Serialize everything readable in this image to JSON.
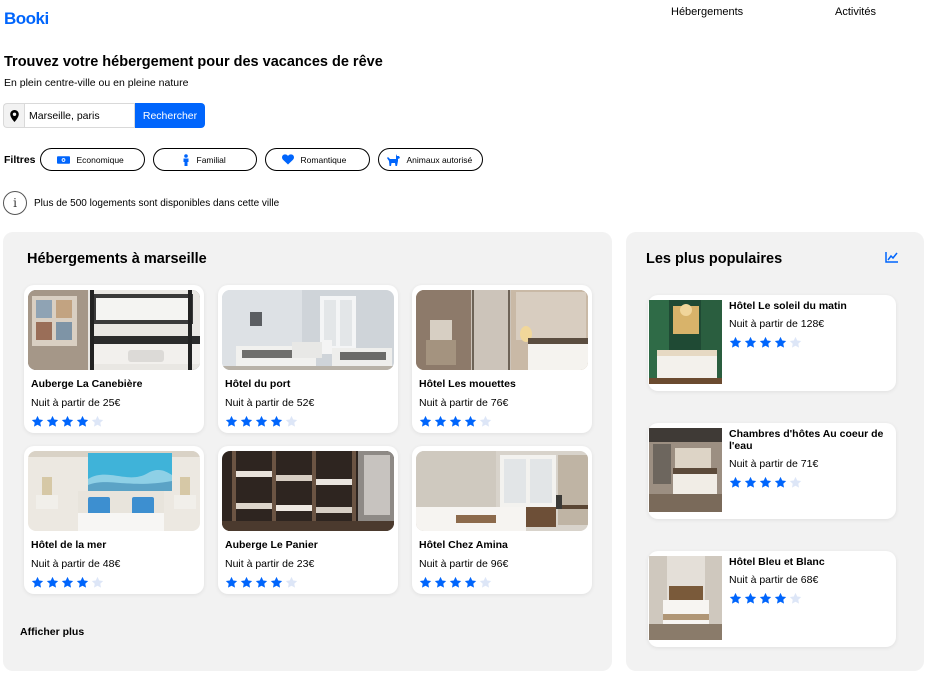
{
  "header": {
    "logo": "Booki",
    "nav": [
      "Hébergements",
      "Activités"
    ]
  },
  "hero": {
    "title": "Trouvez votre hébergement pour des vacances de rêve",
    "subtitle": "En plein centre-ville ou en pleine nature"
  },
  "search": {
    "icon": "location-pin-icon",
    "value": "Marseille, paris",
    "button_label": "Rechercher"
  },
  "filters": {
    "label": "Filtres",
    "items": [
      {
        "label": "Economique",
        "icon": "money-icon"
      },
      {
        "label": "Familial",
        "icon": "person-icon"
      },
      {
        "label": "Romantique",
        "icon": "heart-icon"
      },
      {
        "label": "Animaux autorisé",
        "icon": "dog-icon"
      }
    ]
  },
  "info": {
    "icon": "info-icon",
    "text": "Plus de 500 logements sont disponibles dans cette ville"
  },
  "listings": {
    "title": "Hébergements à marseille",
    "more_label": "Afficher plus",
    "cards": [
      {
        "name": "Auberge La Canebière",
        "price": "Nuit à partir de 25€",
        "rating": 4
      },
      {
        "name": "Hôtel du port",
        "price": "Nuit à partir de 52€",
        "rating": 4
      },
      {
        "name": "Hôtel Les mouettes",
        "price": "Nuit à partir de 76€",
        "rating": 4
      },
      {
        "name": "Hôtel de la mer",
        "price": "Nuit à partir de 48€",
        "rating": 4
      },
      {
        "name": "Auberge Le Panier",
        "price": "Nuit à partir de 23€",
        "rating": 4
      },
      {
        "name": "Hôtel Chez Amina",
        "price": "Nuit à partir de 96€",
        "rating": 4
      }
    ]
  },
  "popular": {
    "title": "Les plus populaires",
    "icon": "trending-chart-icon",
    "items": [
      {
        "name": "Hôtel Le soleil du matin",
        "price": "Nuit à partir de 128€",
        "rating": 4
      },
      {
        "name": "Chambres d'hôtes Au coeur de l'eau",
        "price": "Nuit à partir de 71€",
        "rating": 4
      },
      {
        "name": "Hôtel Bleu et Blanc",
        "price": "Nuit à partir de 68€",
        "rating": 4
      }
    ]
  },
  "colors": {
    "brand": "#0065fc",
    "star_on": "#0065fc",
    "star_off": "#dde6f7",
    "panel": "#f2f2f2"
  }
}
